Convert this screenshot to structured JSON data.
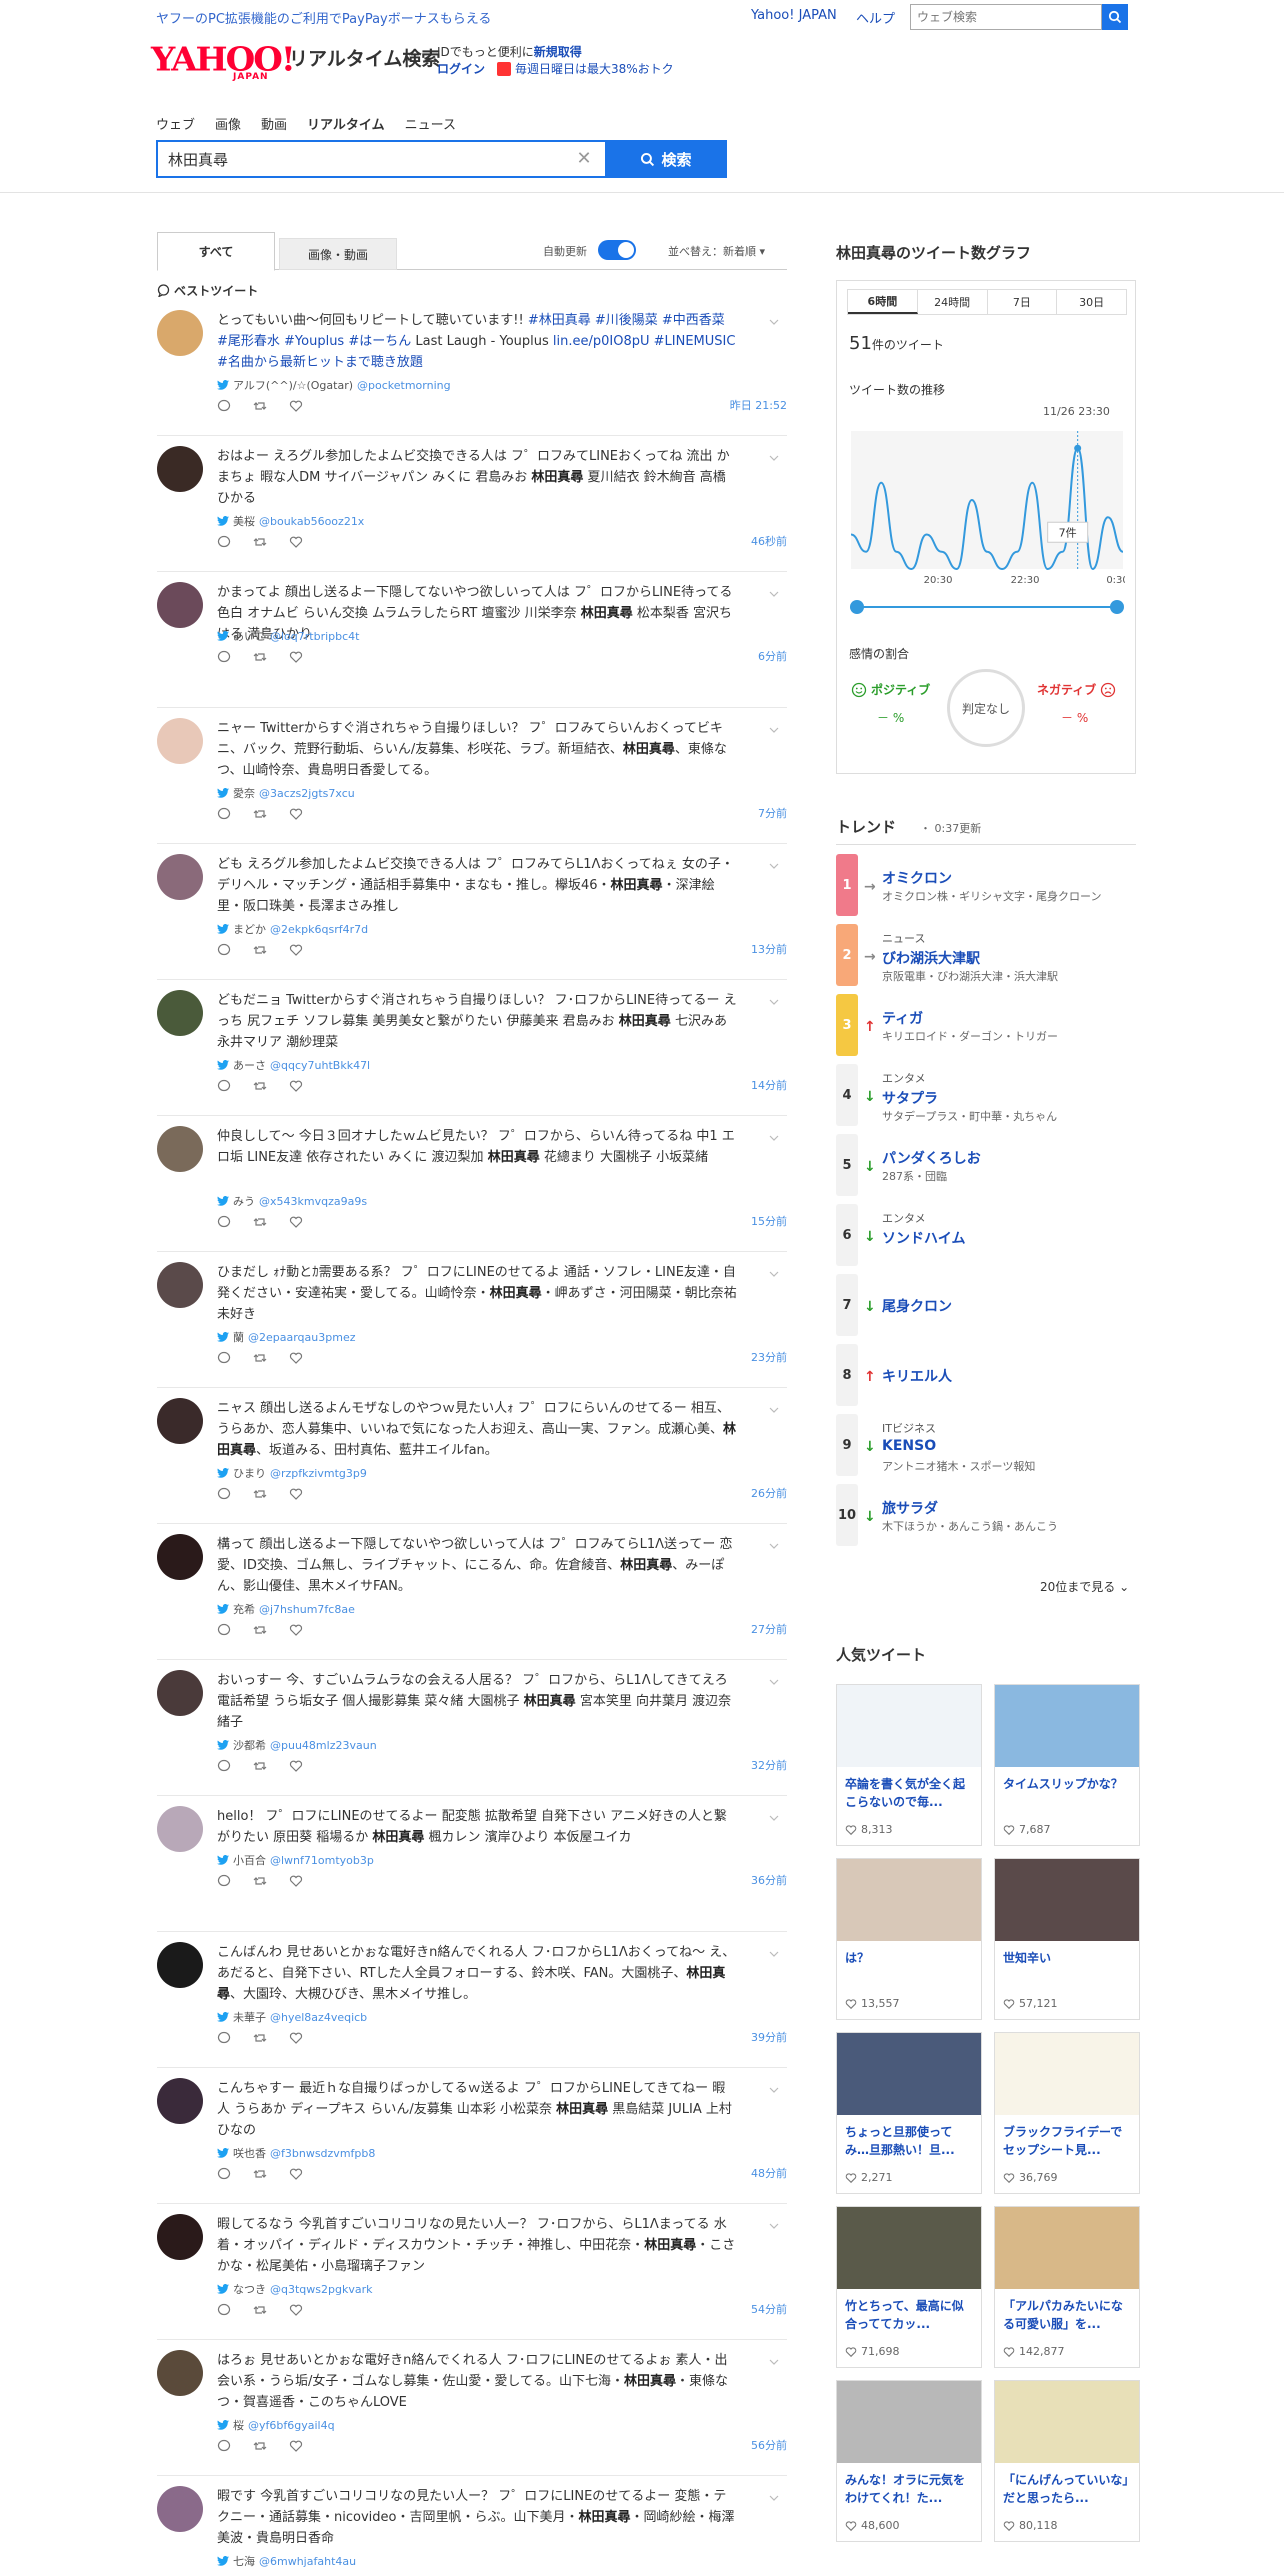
{
  "topbar": {
    "promo": "ヤフーのPC拡張機能のご利用でPayPayボーナスもらえる",
    "yahoo_japan": "Yahoo! JAPAN",
    "help": "ヘルプ",
    "search_placeholder": "ウェブ検索"
  },
  "header": {
    "logo": "YAHOO!",
    "logo_sub": "JAPAN",
    "service": "リアルタイム検索",
    "id_text": "IDでもっと便利に",
    "register": "新規取得",
    "login": "ログイン",
    "campaign": "毎週日曜日は最大38%おトク"
  },
  "nav": [
    "ウェブ",
    "画像",
    "動画",
    "リアルタイム",
    "ニュース"
  ],
  "search": {
    "query": "林田真尋",
    "button": "検索"
  },
  "tabs": {
    "all": "すべて",
    "media": "画像・動画",
    "auto_update": "自動更新",
    "sort": "並べ替え：新着順"
  },
  "best_tweet_label": "ベストツイート",
  "tweets": [
    {
      "pre": "とってもいい曲〜何回もリピートして聴いています!! ",
      "tags1": "#林田真尋 #川後陽菜 #中西香菜 #尾形春水 #Youplus #はーちん",
      "mid": " Last Laugh - Youplus ",
      "link": "lin.ee/p0IO8pU",
      "tags2": " #LINEMUSIC #名曲から最新ヒットまで聴き放題",
      "post": "",
      "name": "アルフ(^^)/☆(Ogatar)",
      "handle": "@pocketmorning",
      "ago": "昨日 21:52",
      "color": "#d9a86b"
    },
    {
      "pre": "おはよー えろグル参加したよムビ交換できる人は フ゜ロフみてLINEおくってね 流出 かまちょ 暇な人DM サイバージャパン みくに 君島みお ",
      "bold": "林田真尋",
      "post": " 夏川結衣 鈴木絢音 高橋ひかる",
      "name": "美桜",
      "handle": "@boukab56ooz21x",
      "ago": "46秒前",
      "color": "#3a2a25"
    },
    {
      "pre": "かまってよ 顔出し送るよー下隠してないやつ欲しいって人は フ゜ロフからLINE待ってる 色白 オナムビ らいん交換 ムラムラしたらRT 壇蜜沙 川栄李奈 ",
      "bold": "林田真尋",
      "post": " 松本梨香 宮沢ちはる 満島ひかり",
      "name": "あいこ",
      "handle": "@loq7rtbripbc4t",
      "ago": "6分前",
      "color": "#6b4a5a"
    },
    {
      "pre": "ニャー Twitterからすぐ消されちゃう自撮りほしい？ フ゜ロフみてらいんおくってビキニ、バック、荒野行動垢、らいん/友募集、杉咲花、ラブ。新垣結衣、",
      "bold": "林田真尋",
      "post": "、東條なつ、山崎怜奈、貴島明日香愛してる。",
      "name": "愛奈",
      "handle": "@3aczs2jgts7xcu",
      "ago": "7分前",
      "color": "#e8c8b8"
    },
    {
      "pre": "ども えろグル参加したよムビ交換できる人は フ゜ロフみてらL1Λおくってねぇ 女の子・デリヘル・マッチング・通話相手募集中・まなも・推し。欅坂46・",
      "bold": "林田真尋",
      "post": "・深津絵里・阪口珠美・長澤まさみ推し",
      "name": "まどか",
      "handle": "@2ekpk6qsrf4r7d",
      "ago": "13分前",
      "color": "#8a6a7a"
    },
    {
      "pre": "どもだニョ Twitterからすぐ消されちゃう自撮りほしい？ フ･ロフからLINE待ってるー えっち 尻フェチ ソフレ募集 美男美女と繋がりたい 伊藤美来 君島みお ",
      "bold": "林田真尋",
      "post": " 七沢みあ 永井マリア 潮紗理菜",
      "name": "あーさ",
      "handle": "@qqcy7uhtBkk47l",
      "ago": "14分前",
      "color": "#4a5a3a"
    },
    {
      "pre": "仲良しして〜 今日３回オナしたｗムビ見たい？ フ゜ロフから、らいん待ってるね 中1 エロ垢 LINE友達 依存されたい みくに 渡辺梨加 ",
      "bold": "林田真尋",
      "post": " 花總まり 大園桃子 小坂菜緒",
      "name": "みう",
      "handle": "@x543kmvqza9a9s",
      "ago": "15分前",
      "color": "#7a6a5a"
    },
    {
      "pre": "ひまだし ｫﾅ動とｶ需要ある系？ フ゜ロフにLINEのせてるよ 通話・ソフレ・LINE友達・自発ください・安達祐実・愛してる。山崎怜奈・",
      "bold": "林田真尋",
      "post": "・岬あずさ・河田陽菜・朝比奈祐未好き",
      "name": "蘭",
      "handle": "@2epaarqau3pmez",
      "ago": "23分前",
      "color": "#5a4a4a"
    },
    {
      "pre": "ニャス 顔出し送るよんモザなしのやつｗ見たい人ｫ フ゜ロフにらいんのせてるー 相互、うらあか、恋人募集中、いいねで気になった人お迎え、高山一実、ファン。成瀬心美、",
      "bold": "林田真尋",
      "post": "、坂道みる、田村真佑、藍井エイルfan。",
      "name": "ひまり",
      "handle": "@rzpfkzivmtg3p9",
      "ago": "26分前",
      "color": "#3a2a2a"
    },
    {
      "pre": "構って 顔出し送るよー下隠してないやつ欲しいって人は フ゜ロフみてらL1Λ送ってー 恋愛、ID交換、ゴム無し、ライブチャット、にこるん、命。佐倉綾音、",
      "bold": "林田真尋",
      "post": "、みーぽん、影山優佳、黒木メイサFAN。",
      "name": "充希",
      "handle": "@j7hshum7fc8ae",
      "ago": "27分前",
      "color": "#2a1a1a"
    },
    {
      "pre": "おいっすー 今、すごいムラムラなの会える人居る？ フ゜ロフから、らL1Λしてきてえろ 電話希望 うら垢女子 個人撮影募集 菜々緒 大園桃子 ",
      "bold": "林田真尋",
      "post": " 宮本笑里 向井葉月 渡辺奈緒子",
      "name": "沙都希",
      "handle": "@puu48mlz23vaun",
      "ago": "32分前",
      "color": "#4a3a3a"
    },
    {
      "pre": "hello！ フ゜ロフにLINEのせてるよー 配変態 拡散希望 自発下さい アニメ好きの人と繋がりたい 原田葵 稲場るか ",
      "bold": "林田真尋",
      "post": " 楓カレン 濱岸ひより 本仮屋ユイカ",
      "name": "小百合",
      "handle": "@lwnf71omtyob3p",
      "ago": "36分前",
      "color": "#b8a8b8"
    },
    {
      "pre": "こんばんわ 見せあいとかぉな電好きn絡んでくれる人 フ･ロフからL1Λおくってね〜 え、あだると、自発下さい、RTした人全員フォローする、鈴木咲、FAN。大園桃子、",
      "bold": "林田真尋",
      "post": "、大園玲、大槻ひびき、黒木メイサ推し。",
      "name": "未華子",
      "handle": "@hyel8az4veqicb",
      "ago": "39分前",
      "color": "#1a1a1a"
    },
    {
      "pre": "こんちゃすー 最近ｈな自撮りばっかしてるｗ送るよ フ゜ロフからLINEしてきてねー 暇人 うらあか ディープキス らいん/友募集 山本彩 小松菜奈 ",
      "bold": "林田真尋",
      "post": " 黒島結菜 JULIA 上村ひなの",
      "name": "咲也香",
      "handle": "@f3bnwsdzvmfpb8",
      "ago": "48分前",
      "color": "#3a2a3a"
    },
    {
      "pre": "暇してるなう 今乳首すごいコリコリなの見たい人ー？ フ･ロフから、らL1Λまってる 水着・オッパイ・ディルド・ディスカウント・チッチ・神推し、中田花奈・",
      "bold": "林田真尋",
      "post": "・こさかな・松尾美佑・小島瑠璃子ファン",
      "name": "なつき",
      "handle": "@q3tqws2pgkvark",
      "ago": "54分前",
      "color": "#2a1a1a"
    },
    {
      "pre": "はろぉ 見せあいとかぉな電好きn絡んでくれる人 フ･ロフにLINEのせてるよぉ 素人・出会い系・うら垢/女子・ゴムなし募集・佐山愛・愛してる。山下七海・",
      "bold": "林田真尋",
      "post": "・東條なつ・賀喜遥香・このちゃんLOVE",
      "name": "桜",
      "handle": "@yf6bf6gyail4q",
      "ago": "56分前",
      "color": "#5a4a3a"
    },
    {
      "pre": "暇です 今乳首すごいコリコリなの見たい人ー？ フ゜ロフにLINEのせてるよー 変態・テクニー・通話募集・nicovideo・吉岡里帆・らぶ。山下美月・",
      "bold": "林田真尋",
      "post": "・岡崎紗絵・梅澤美波・貴島明日香命",
      "name": "七海",
      "handle": "@6mwhjafaht4au",
      "ago": "58分前",
      "color": "#8a6a8a"
    }
  ],
  "graph": {
    "title": "林田真尋のツイート数グラフ",
    "tabs": [
      "6時間",
      "24時間",
      "7日",
      "30日"
    ],
    "count": "51",
    "count_unit": "件のツイート",
    "trend_label": "ツイート数の推移",
    "time": "11/26 23:30",
    "tooltip": "7件",
    "sentiment_label": "感情の割合",
    "positive": "ポジティブ",
    "negative": "ネガティブ",
    "pos_value": "－ %",
    "neg_value": "－ %",
    "judge": "判定なし"
  },
  "chart_data": {
    "type": "line",
    "x_ticks": [
      "20:30",
      "22:30",
      "0:30"
    ],
    "series": [
      {
        "values": [
          2,
          1,
          5,
          1,
          0,
          2,
          1,
          0,
          4,
          1,
          0,
          1,
          5,
          0,
          1,
          7,
          0,
          3,
          1
        ]
      }
    ],
    "ylim": [
      0,
      8
    ]
  },
  "trend": {
    "title": "トレンド",
    "updated": "0:37更新",
    "items": [
      {
        "rank": "1",
        "arrow": "→",
        "cat": "",
        "word": "オミクロン",
        "rel": "オミクロン株・ギリシャ文字・尾身クローン",
        "color": "#f07a8a"
      },
      {
        "rank": "2",
        "arrow": "→",
        "cat": "ニュース",
        "word": "びわ湖浜大津駅",
        "rel": "京阪電車・びわ湖浜大津・浜大津駅",
        "color": "#f8a878"
      },
      {
        "rank": "3",
        "arrow": "↑",
        "cat": "",
        "word": "ティガ",
        "rel": "キリエロイド・ダーゴン・トリガー",
        "color": "#f5c842"
      },
      {
        "rank": "4",
        "arrow": "↓",
        "cat": "エンタメ",
        "word": "サタプラ",
        "rel": "サタデープラス・町中華・丸ちゃん",
        "color": ""
      },
      {
        "rank": "5",
        "arrow": "↓",
        "cat": "",
        "word": "パンダくろしお",
        "rel": "287系・団臨",
        "color": ""
      },
      {
        "rank": "6",
        "arrow": "↓",
        "cat": "エンタメ",
        "word": "ソンドハイム",
        "rel": "",
        "color": ""
      },
      {
        "rank": "7",
        "arrow": "↓",
        "cat": "",
        "word": "尾身クロン",
        "rel": "",
        "color": ""
      },
      {
        "rank": "8",
        "arrow": "↑",
        "cat": "",
        "word": "キリエル人",
        "rel": "",
        "color": ""
      },
      {
        "rank": "9",
        "arrow": "↓",
        "cat": "ITビジネス",
        "word": "KENSO",
        "rel": "アントニオ猪木・スポーツ報知",
        "color": ""
      },
      {
        "rank": "10",
        "arrow": "↓",
        "cat": "",
        "word": "旅サラダ",
        "rel": "木下ほうか・あんこう鍋・あんこう",
        "color": ""
      }
    ],
    "more": "20位まで見る"
  },
  "popular": {
    "title": "人気ツイート",
    "cards": [
      {
        "text": "卒論を書く気が全く起こらないので毎...",
        "likes": "8,313",
        "bg": "#f0f4f8"
      },
      {
        "text": "タイムスリップかな？",
        "likes": "7,687",
        "bg": "#8ab8e0"
      },
      {
        "text": "は？﻿",
        "likes": "13,557",
        "bg": "#d8c8b8"
      },
      {
        "text": "世知辛い",
        "likes": "57,121",
        "bg": "#5a4a4a"
      },
      {
        "text": "ちょっと旦那使ってみ…旦那熱い！旦...",
        "likes": "2,271",
        "bg": "#4a5a7a"
      },
      {
        "text": "ブラックフライデーでセップシート見...",
        "likes": "36,769",
        "bg": "#f8f4e8"
      },
      {
        "text": "竹とちって、最高に似合っててカッ...",
        "likes": "71,698",
        "bg": "#5a5a4a"
      },
      {
        "text": "「アルパカみたいになる可愛い服」を...",
        "likes": "142,877",
        "bg": "#d8b888"
      },
      {
        "text": "みんな！オラに元気をわけてくれ！た...",
        "likes": "48,600",
        "bg": "#b8b8b8"
      },
      {
        "text": "「にんげんっていいな」だと思ったら...",
        "likes": "80,118",
        "bg": "#e8e0b8"
      }
    ]
  }
}
